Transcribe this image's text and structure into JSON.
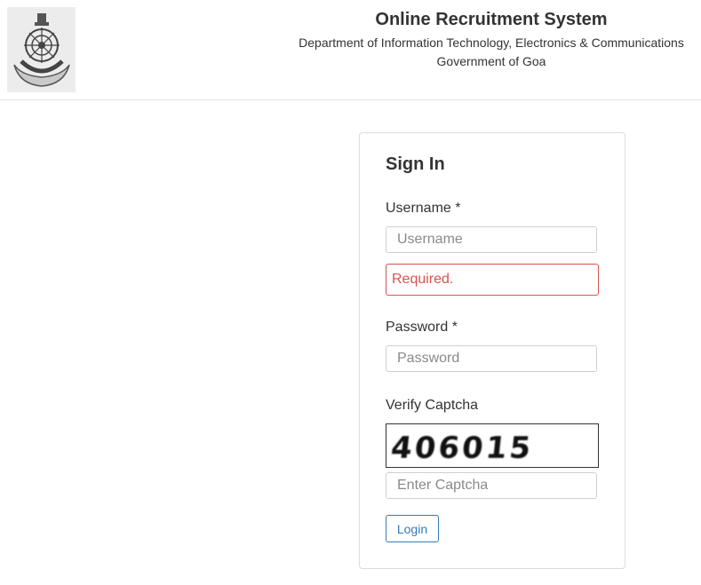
{
  "header": {
    "title": "Online Recruitment System",
    "department": "Department of Information Technology, Electronics & Communications",
    "government": "Government of Goa",
    "emblem_icon": "goa-government-emblem"
  },
  "signin": {
    "heading": "Sign In",
    "username_label": "Username *",
    "username_placeholder": "Username",
    "username_value": "",
    "username_error": "Required.",
    "password_label": "Password *",
    "password_placeholder": "Password",
    "password_value": "",
    "captcha_label": "Verify Captcha",
    "captcha_text": "406015",
    "captcha_placeholder": "Enter Captcha",
    "captcha_value": "",
    "login_label": "Login"
  },
  "colors": {
    "error": "#d9534f",
    "accent": "#337ab7",
    "text": "#333333",
    "border": "#dcdcdc"
  }
}
